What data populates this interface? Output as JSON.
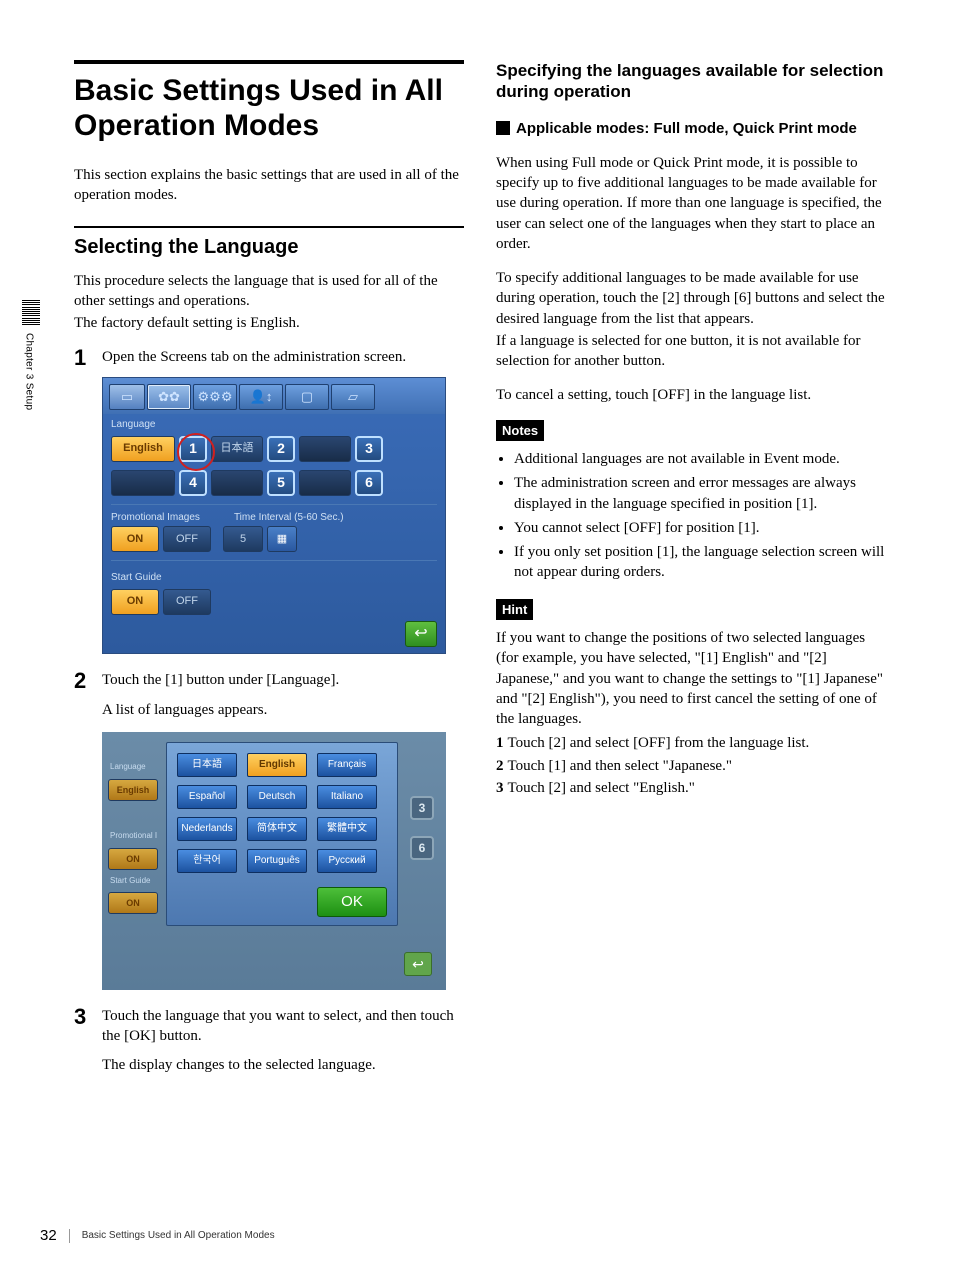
{
  "sideTab": {
    "label": "Chapter 3  Setup"
  },
  "col1": {
    "title": "Basic Settings Used in All Operation Modes",
    "intro": "This section explains the basic settings that are used in all of the operation modes.",
    "h2": "Selecting the Language",
    "p1": "This procedure selects the language that is used for all of the other settings and operations.",
    "p2": "The factory default setting is English.",
    "step1": {
      "n": "1",
      "text": "Open the Screens tab on the administration screen."
    },
    "step2": {
      "n": "2",
      "text": "Touch the [1] button under [Language].",
      "sub": "A list of languages appears."
    },
    "step3": {
      "n": "3",
      "text": "Touch the language that you want to select, and then touch the [OK] button.",
      "sub": "The display changes to the selected language."
    }
  },
  "mock1": {
    "labels": {
      "language": "Language",
      "promo": "Promotional Images",
      "timeInterval": "Time Interval (5-60 Sec.)",
      "startGuide": "Start Guide"
    },
    "toolbar": [
      "▭",
      "✿✿",
      "⚙⚙⚙",
      "👤↕",
      "▢",
      "▱"
    ],
    "english": "English",
    "japanese": "日本語",
    "nums": [
      "1",
      "2",
      "3",
      "4",
      "5",
      "6"
    ],
    "on": "ON",
    "off": "OFF",
    "five": "5",
    "cal": "▦",
    "back": "↩"
  },
  "mock2": {
    "left": {
      "language": "Language",
      "english": "English",
      "promo": "Promotional I",
      "on": "ON",
      "sg": "Start Guide"
    },
    "ghost": [
      "3",
      "6"
    ],
    "ok": "OK",
    "langs": [
      [
        "日本語",
        "English",
        "Français"
      ],
      [
        "Español",
        "Deutsch",
        "Italiano"
      ],
      [
        "Nederlands",
        "简体中文",
        "繁體中文"
      ],
      [
        "한국어",
        "Português",
        "Русский"
      ]
    ],
    "back": "↩"
  },
  "col2": {
    "h2": "Specifying the languages available for selection during operation",
    "applicable": "Applicable modes: Full mode, Quick Print mode",
    "p1": "When using Full mode or Quick Print mode, it is possible to specify up to five additional languages to be made available for use during operation. If more than one language is specified, the user can select one of the languages when they start to place an order.",
    "p2": "To specify additional languages to be made available for use during operation, touch the [2] through [6] buttons and select the desired language from the list that appears.",
    "p3": "If a language is selected for one button, it is not available for selection for another button.",
    "p4": "To cancel a setting, touch [OFF] in the language list.",
    "notesLabel": "Notes",
    "notes": [
      "Additional languages are not available in Event mode.",
      "The administration screen and error messages are always displayed in the language specified in position [1].",
      "You cannot select [OFF] for position [1].",
      "If you only set position [1], the language selection screen will not appear during orders."
    ],
    "hintLabel": "Hint",
    "hintP": "If you want to change the positions of two selected languages (for example, you have selected, \"[1] English\" and \"[2] Japanese,\" and you want to change the settings to \"[1] Japanese\" and \"[2] English\"), you need to first cancel the setting of one of the languages.",
    "hintList": [
      {
        "n": "1",
        "t": "Touch [2] and select [OFF] from the language list."
      },
      {
        "n": "2",
        "t": "Touch [1] and then select \"Japanese.\""
      },
      {
        "n": "3",
        "t": "Touch [2] and select \"English.\""
      }
    ]
  },
  "footer": {
    "page": "32",
    "text": "Basic Settings Used in All Operation Modes"
  }
}
